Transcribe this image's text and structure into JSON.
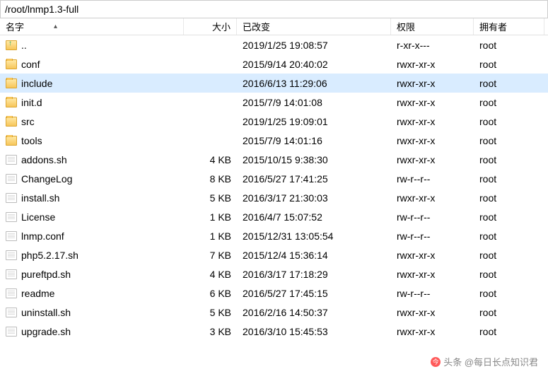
{
  "path": "/root/lnmp1.3-full",
  "columns": {
    "name": "名字",
    "size": "大小",
    "modified": "已改变",
    "perm": "权限",
    "owner": "拥有者"
  },
  "rows": [
    {
      "icon": "up",
      "name": "..",
      "size": "",
      "modified": "2019/1/25 19:08:57",
      "perm": "r-xr-x---",
      "owner": "root",
      "selected": false
    },
    {
      "icon": "folder",
      "name": "conf",
      "size": "",
      "modified": "2015/9/14 20:40:02",
      "perm": "rwxr-xr-x",
      "owner": "root",
      "selected": false
    },
    {
      "icon": "folder",
      "name": "include",
      "size": "",
      "modified": "2016/6/13 11:29:06",
      "perm": "rwxr-xr-x",
      "owner": "root",
      "selected": true
    },
    {
      "icon": "folder",
      "name": "init.d",
      "size": "",
      "modified": "2015/7/9 14:01:08",
      "perm": "rwxr-xr-x",
      "owner": "root",
      "selected": false
    },
    {
      "icon": "folder",
      "name": "src",
      "size": "",
      "modified": "2019/1/25 19:09:01",
      "perm": "rwxr-xr-x",
      "owner": "root",
      "selected": false
    },
    {
      "icon": "folder",
      "name": "tools",
      "size": "",
      "modified": "2015/7/9 14:01:16",
      "perm": "rwxr-xr-x",
      "owner": "root",
      "selected": false
    },
    {
      "icon": "file",
      "name": "addons.sh",
      "size": "4 KB",
      "modified": "2015/10/15 9:38:30",
      "perm": "rwxr-xr-x",
      "owner": "root",
      "selected": false
    },
    {
      "icon": "file",
      "name": "ChangeLog",
      "size": "8 KB",
      "modified": "2016/5/27 17:41:25",
      "perm": "rw-r--r--",
      "owner": "root",
      "selected": false
    },
    {
      "icon": "file",
      "name": "install.sh",
      "size": "5 KB",
      "modified": "2016/3/17 21:30:03",
      "perm": "rwxr-xr-x",
      "owner": "root",
      "selected": false
    },
    {
      "icon": "file",
      "name": "License",
      "size": "1 KB",
      "modified": "2016/4/7 15:07:52",
      "perm": "rw-r--r--",
      "owner": "root",
      "selected": false
    },
    {
      "icon": "file",
      "name": "lnmp.conf",
      "size": "1 KB",
      "modified": "2015/12/31 13:05:54",
      "perm": "rw-r--r--",
      "owner": "root",
      "selected": false
    },
    {
      "icon": "file",
      "name": "php5.2.17.sh",
      "size": "7 KB",
      "modified": "2015/12/4 15:36:14",
      "perm": "rwxr-xr-x",
      "owner": "root",
      "selected": false
    },
    {
      "icon": "file",
      "name": "pureftpd.sh",
      "size": "4 KB",
      "modified": "2016/3/17 17:18:29",
      "perm": "rwxr-xr-x",
      "owner": "root",
      "selected": false
    },
    {
      "icon": "file",
      "name": "readme",
      "size": "6 KB",
      "modified": "2016/5/27 17:45:15",
      "perm": "rw-r--r--",
      "owner": "root",
      "selected": false
    },
    {
      "icon": "file",
      "name": "uninstall.sh",
      "size": "5 KB",
      "modified": "2016/2/16 14:50:37",
      "perm": "rwxr-xr-x",
      "owner": "root",
      "selected": false
    },
    {
      "icon": "file",
      "name": "upgrade.sh",
      "size": "3 KB",
      "modified": "2016/3/10 15:45:53",
      "perm": "rwxr-xr-x",
      "owner": "root",
      "selected": false
    }
  ],
  "watermark": "头条 @每日长点知识君"
}
